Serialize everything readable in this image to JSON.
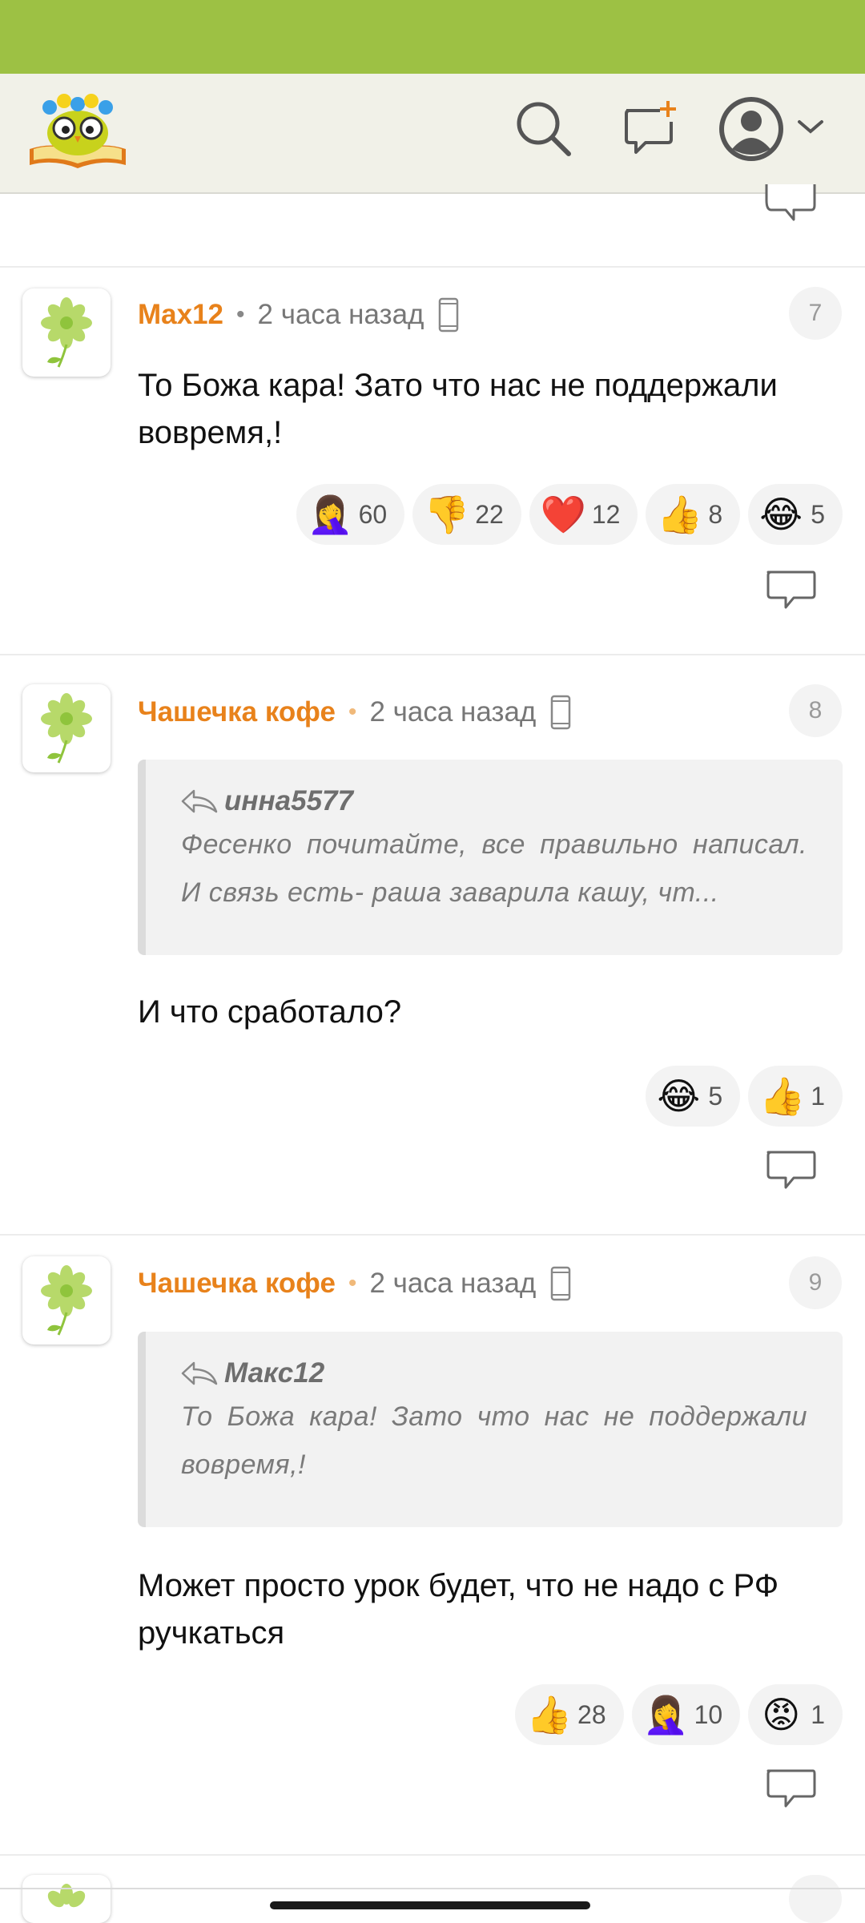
{
  "colors": {
    "status_bar": "#9dc144",
    "header_bg": "#f1f1e8",
    "author": "#e8821b",
    "reaction_bg": "#f3f3f3"
  },
  "header": {
    "logo": "owl-on-book-logo",
    "icons": [
      "search-icon",
      "new-post-icon",
      "user-avatar-icon",
      "chevron-down-icon"
    ]
  },
  "comments": [
    {
      "author": "Max12",
      "time": "2 часа назад",
      "number": "7",
      "text": "То Божа кара! Зато что нас не поддержали вовремя,!",
      "reactions": [
        {
          "emoji": "🤦‍♀️",
          "count": "60"
        },
        {
          "emoji": "👎",
          "count": "22"
        },
        {
          "emoji": "❤️",
          "count": "12"
        },
        {
          "emoji": "👍",
          "count": "8"
        },
        {
          "emoji": "😂",
          "count": "5"
        }
      ]
    },
    {
      "author": "Чашечка кофе",
      "time": "2 часа назад",
      "number": "8",
      "quote": {
        "author": "инна5577",
        "text": "Фесенко почитайте, все правильно написал. И связь есть- раша заварила кашу, чт..."
      },
      "text": "И что сработало?",
      "reactions": [
        {
          "emoji": "😂",
          "count": "5"
        },
        {
          "emoji": "👍",
          "count": "1"
        }
      ]
    },
    {
      "author": "Чашечка кофе",
      "time": "2 часа назад",
      "number": "9",
      "quote": {
        "author": "Макс12",
        "text": "То Божа кара! Зато что нас не поддержали вовремя,!"
      },
      "text": "Может просто урок будет, что не надо с РФ ручкаться",
      "reactions": [
        {
          "emoji": "👍",
          "count": "28"
        },
        {
          "emoji": "🤦‍♀️",
          "count": "10"
        },
        {
          "emoji": "😡",
          "count": "1"
        }
      ]
    }
  ]
}
